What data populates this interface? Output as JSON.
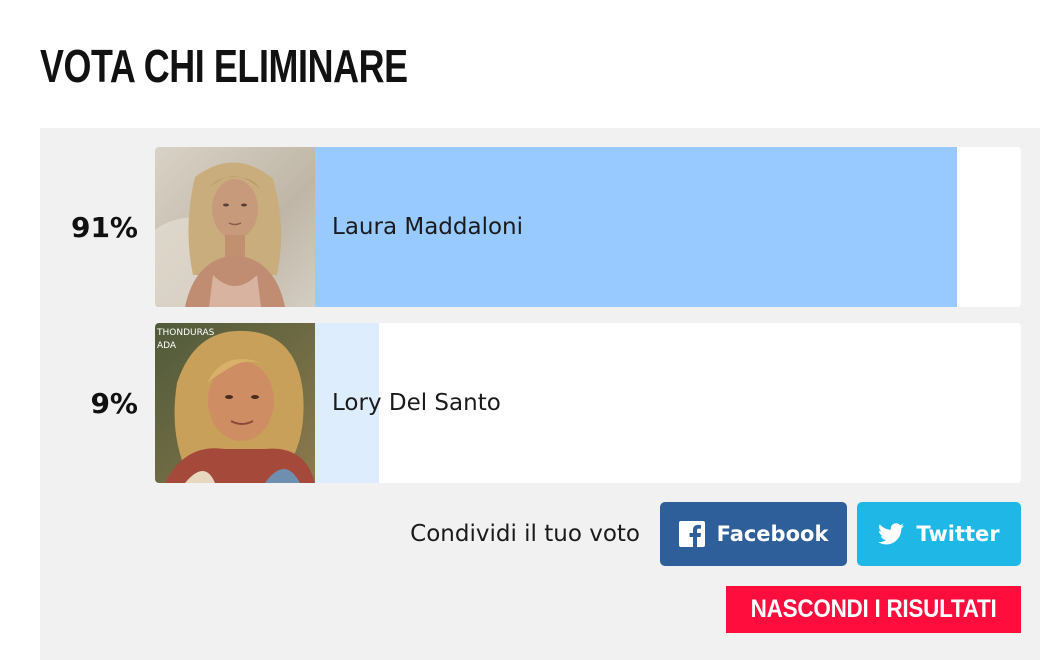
{
  "poll": {
    "title": "VOTA CHI ELIMINARE",
    "options": [
      {
        "name": "Laura Maddaloni",
        "percent_label": "91%",
        "percent": 91,
        "bar_color": "#99caff"
      },
      {
        "name": "Lory Del Santo",
        "percent_label": "9%",
        "percent": 9,
        "bar_color": "#ddedfe"
      }
    ],
    "photo_caption": "THONDURAS\nADA"
  },
  "share": {
    "label": "Condividi il tuo voto",
    "facebook_label": "Facebook",
    "facebook_icon": "facebook-icon",
    "facebook_color": "#2f5f9a",
    "twitter_label": "Twitter",
    "twitter_icon": "twitter-icon",
    "twitter_color": "#1eb7e6"
  },
  "hide_results": {
    "label": "NASCONDI I RISULTATI",
    "color": "#ff0d3c"
  }
}
